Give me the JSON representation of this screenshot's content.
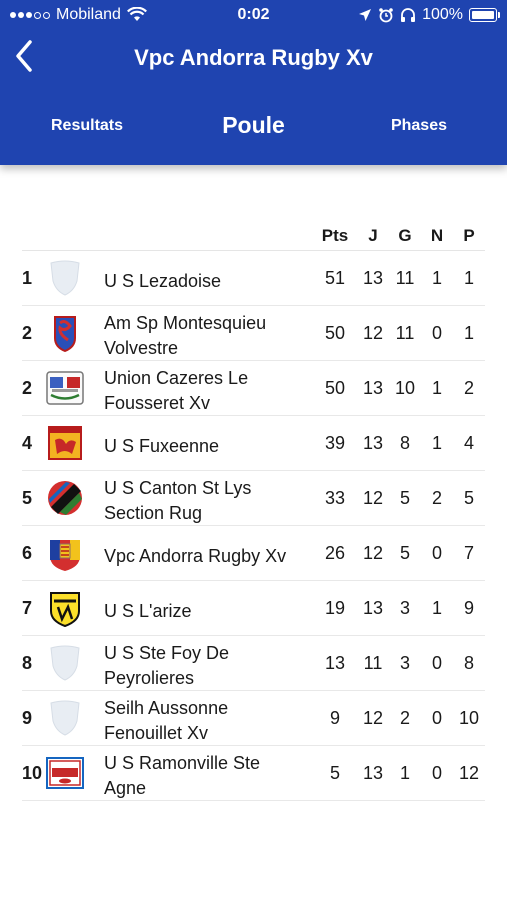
{
  "status_bar": {
    "carrier": "Mobiland",
    "time": "0:02",
    "battery": "100%",
    "icons": [
      "signal-dots",
      "wifi-icon",
      "location-icon",
      "alarm-icon",
      "headphones-icon",
      "battery-icon"
    ]
  },
  "nav": {
    "title": "Vpc Andorra Rugby Xv",
    "back_icon": "chevron-left-icon"
  },
  "tabs": {
    "left": "Resultats",
    "center": "Poule",
    "right": "Phases"
  },
  "colors": {
    "header_bg": "#1f44b0",
    "text": "#1a1a1a"
  },
  "table": {
    "headers": [
      "Pts",
      "J",
      "G",
      "N",
      "P"
    ],
    "rows": [
      {
        "rank": "1",
        "team": "U S Lezadoise",
        "pts": "51",
        "j": "13",
        "g": "11",
        "n": "1",
        "p": "1",
        "logo": "shield-placeholder"
      },
      {
        "rank": "2",
        "team": "Am Sp Montesquieu Volvestre",
        "pts": "50",
        "j": "12",
        "g": "11",
        "n": "0",
        "p": "1",
        "logo": "crest-blue-red"
      },
      {
        "rank": "2",
        "team": "Union Cazeres Le Fousseret Xv",
        "pts": "50",
        "j": "13",
        "g": "10",
        "n": "1",
        "p": "2",
        "logo": "crest-union"
      },
      {
        "rank": "4",
        "team": "U S Fuxeenne",
        "pts": "39",
        "j": "13",
        "g": "8",
        "n": "1",
        "p": "4",
        "logo": "crest-yellow-red"
      },
      {
        "rank": "5",
        "team": "U S Canton St Lys Section Rug",
        "pts": "33",
        "j": "12",
        "g": "5",
        "n": "2",
        "p": "5",
        "logo": "crest-circle-stripes"
      },
      {
        "rank": "6",
        "team": "Vpc Andorra Rugby Xv",
        "pts": "26",
        "j": "12",
        "g": "5",
        "n": "0",
        "p": "7",
        "logo": "crest-andorra"
      },
      {
        "rank": "7",
        "team": "U S L'arize",
        "pts": "19",
        "j": "13",
        "g": "3",
        "n": "1",
        "p": "9",
        "logo": "crest-yellow-black"
      },
      {
        "rank": "8",
        "team": "U S Ste Foy De Peyrolieres",
        "pts": "13",
        "j": "11",
        "g": "3",
        "n": "0",
        "p": "8",
        "logo": "shield-placeholder"
      },
      {
        "rank": "9",
        "team": "Seilh Aussonne Fenouillet Xv",
        "pts": "9",
        "j": "12",
        "g": "2",
        "n": "0",
        "p": "10",
        "logo": "shield-placeholder"
      },
      {
        "rank": "10",
        "team": "U S Ramonville Ste Agne",
        "pts": "5",
        "j": "13",
        "g": "1",
        "n": "0",
        "p": "12",
        "logo": "crest-rugby-badge"
      }
    ]
  }
}
